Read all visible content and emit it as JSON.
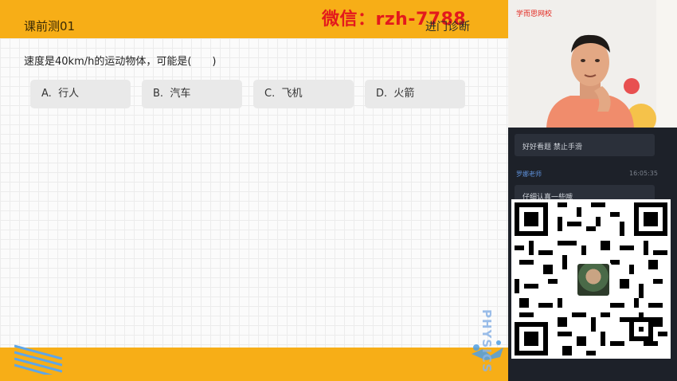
{
  "slide": {
    "title": "课前测01",
    "watermark": "微信：rzh-7788",
    "section_label": "进门诊断",
    "question": "速度是40km/h的运动物体，可能是(　　)",
    "options": [
      {
        "letter": "A.",
        "text": "行人"
      },
      {
        "letter": "B.",
        "text": "汽车"
      },
      {
        "letter": "C.",
        "text": "飞机"
      },
      {
        "letter": "D.",
        "text": "火箭"
      }
    ],
    "corner_text": "PHYSICS"
  },
  "side": {
    "brand": "学而思网校",
    "chat": {
      "message1": "好好看题 禁止手滑",
      "sender": "罗娜老师",
      "time": "16:05:35",
      "message2": "仔细认真一些哦"
    }
  },
  "colors": {
    "accent": "#f7ae17",
    "watermark": "#e3191d",
    "panel": "#1d2129"
  }
}
